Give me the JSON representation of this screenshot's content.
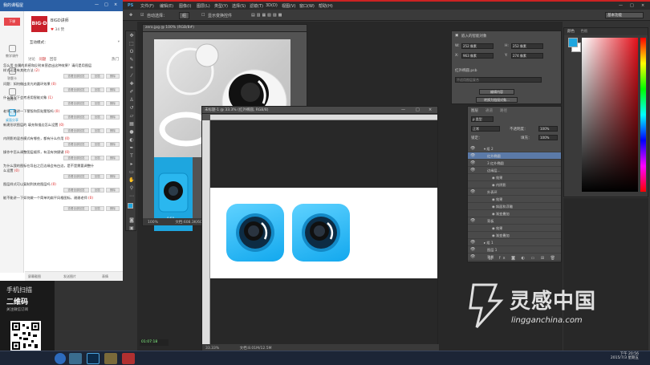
{
  "chat_panel": {
    "title": "我的课程屋",
    "controls": [
      "—",
      "□",
      "×"
    ],
    "nav": [
      {
        "label": "下课",
        "icon": "class-icon"
      },
      {
        "label": "教学课件",
        "icon": "courseware-icon"
      },
      {
        "label": "答题卡",
        "icon": "quiz-icon"
      },
      {
        "label": "摄像头",
        "icon": "camera-icon"
      },
      {
        "label": "桌面分享",
        "icon": "screen-share-icon"
      }
    ],
    "profile": {
      "avatar_text": "BIG·D",
      "name": "BIGD讲师",
      "likes": "34",
      "likes_label": "赞"
    },
    "mode_label": "互动模式：",
    "mode_value": "▾",
    "question_tabs": [
      "讨论",
      "问题",
      "回答",
      "热门"
    ],
    "questions": [
      {
        "text": "怎么用 金属的质感和反射来营造出这种效果？请问是用图层样式还是有其他方法",
        "count": "(2)"
      },
      {
        "text": "问题：如何做出发光的圆环效果",
        "count": "(0)"
      },
      {
        "text": "什么情况下会考虑用智能对象",
        "count": "(1)"
      },
      {
        "text": "老师，能讲一下蒙版和剪贴蒙版吗",
        "count": "(0)"
      },
      {
        "text": "新建形状图层的 填充和描边怎么设置",
        "count": "(0)"
      },
      {
        "text": "内阴影的混合模式有哪些，都有什么作用",
        "count": "(0)"
      },
      {
        "text": "操作中怎么调整图层顺序，有没有快捷键",
        "count": "(0)"
      },
      {
        "text": "为什么我的图标在导出之后边缘会有白边，是不是需要调整什么设置",
        "count": "(0)"
      },
      {
        "text": "图层样式可以复制到其他图层吗",
        "count": "(0)"
      },
      {
        "text": "能不能讲一下如何做一个简单的扁平风格图标，谢谢老师",
        "count": "(0)"
      }
    ],
    "btn_a": "查看全部回答",
    "btn_b": "回答",
    "btn_c": "删除",
    "bottom": [
      "屏幕截图",
      "发送图片",
      "表情"
    ]
  },
  "qr_promo": {
    "line1": "手机扫描",
    "line2": "二维码",
    "line3": "关注微信订阅"
  },
  "photoshop": {
    "menu": [
      "PS",
      "文件(F)",
      "编辑(E)",
      "图像(I)",
      "图层(L)",
      "类型(Y)",
      "选择(S)",
      "滤镜(T)",
      "3D(D)",
      "视图(V)",
      "窗口(W)",
      "帮助(H)"
    ],
    "options": {
      "auto_select": "自动选择：",
      "group": "组",
      "transform": "显示变换控件"
    },
    "workspace": "基本功能",
    "doc1": {
      "tab": "zero.jpg @ 100% (RGB/8#)",
      "zoom": "100%",
      "size": "文档:608.3K/608.3K",
      "brand": "zero",
      "blue_label": "8:58"
    },
    "doc2": {
      "tab": "未标题-1 @ 33.3% (红外椭圆, RGB/8)",
      "zoom": "33.33%",
      "size": "文档:8.01M/12.5M"
    },
    "properties": {
      "title": "嵌入的智能对象",
      "w_label": "W:",
      "w": "252 像素",
      "h_label": "H:",
      "h": "252 像素",
      "x_label": "X:",
      "x": "963 像素",
      "y_label": "Y:",
      "y": "274 像素",
      "file": "红外椭圆.psb",
      "layer_comp": "不适用图层复合",
      "edit_btn": "编辑内容",
      "convert_btn": "转换为链接对象..."
    },
    "layers": {
      "tabs": [
        "图层",
        "通道",
        "路径"
      ],
      "filter": "ρ 类型",
      "blend": "正常",
      "opacity_label": "不透明度：",
      "opacity": "100%",
      "lock_label": "锁定：",
      "fill_label": "填充：",
      "fill": "100%",
      "rows": [
        {
          "label": "▾ 组 2",
          "eye": "👁",
          "selected": false
        },
        {
          "label": "红外椭圆",
          "eye": "👁",
          "selected": true
        },
        {
          "label": "3 红外椭圆",
          "eye": "👁",
          "selected": false
        },
        {
          "label": "边缘层...",
          "eye": "👁",
          "selected": false
        },
        {
          "label": "◉ 效果",
          "eye": "",
          "selected": false
        },
        {
          "label": "◉ 内阴影",
          "eye": "",
          "selected": false
        },
        {
          "label": "外表环",
          "eye": "👁",
          "selected": false
        },
        {
          "label": "◉ 效果",
          "eye": "",
          "selected": false
        },
        {
          "label": "◉ 斜面和浮雕",
          "eye": "",
          "selected": false
        },
        {
          "label": "◉ 渐变叠加",
          "eye": "",
          "selected": false
        },
        {
          "label": "背板",
          "eye": "👁",
          "selected": false
        },
        {
          "label": "◉ 效果",
          "eye": "",
          "selected": false
        },
        {
          "label": "◉ 渐变叠加",
          "eye": "",
          "selected": false
        },
        {
          "label": "▸ 组 1",
          "eye": "👁",
          "selected": false
        },
        {
          "label": "图层 1",
          "eye": "👁",
          "selected": false
        },
        {
          "label": "背景",
          "eye": "👁",
          "selected": false
        }
      ]
    },
    "color_panel": {
      "tabs": [
        "颜色",
        "色板"
      ],
      "fg": "#1ea6df",
      "bg": "#ffffff"
    },
    "timer": "01:07:18"
  },
  "watermark": {
    "text": "灵感中国",
    "url": "lingganchina.com"
  },
  "taskbar": {
    "time": "下午 20:56",
    "date": "2015/7/3 星期五"
  },
  "colors": {
    "accent": "#1ea6df",
    "chat_title": "#2a5fa5",
    "ps_bg": "#282828",
    "brand_red": "#c9202a"
  }
}
